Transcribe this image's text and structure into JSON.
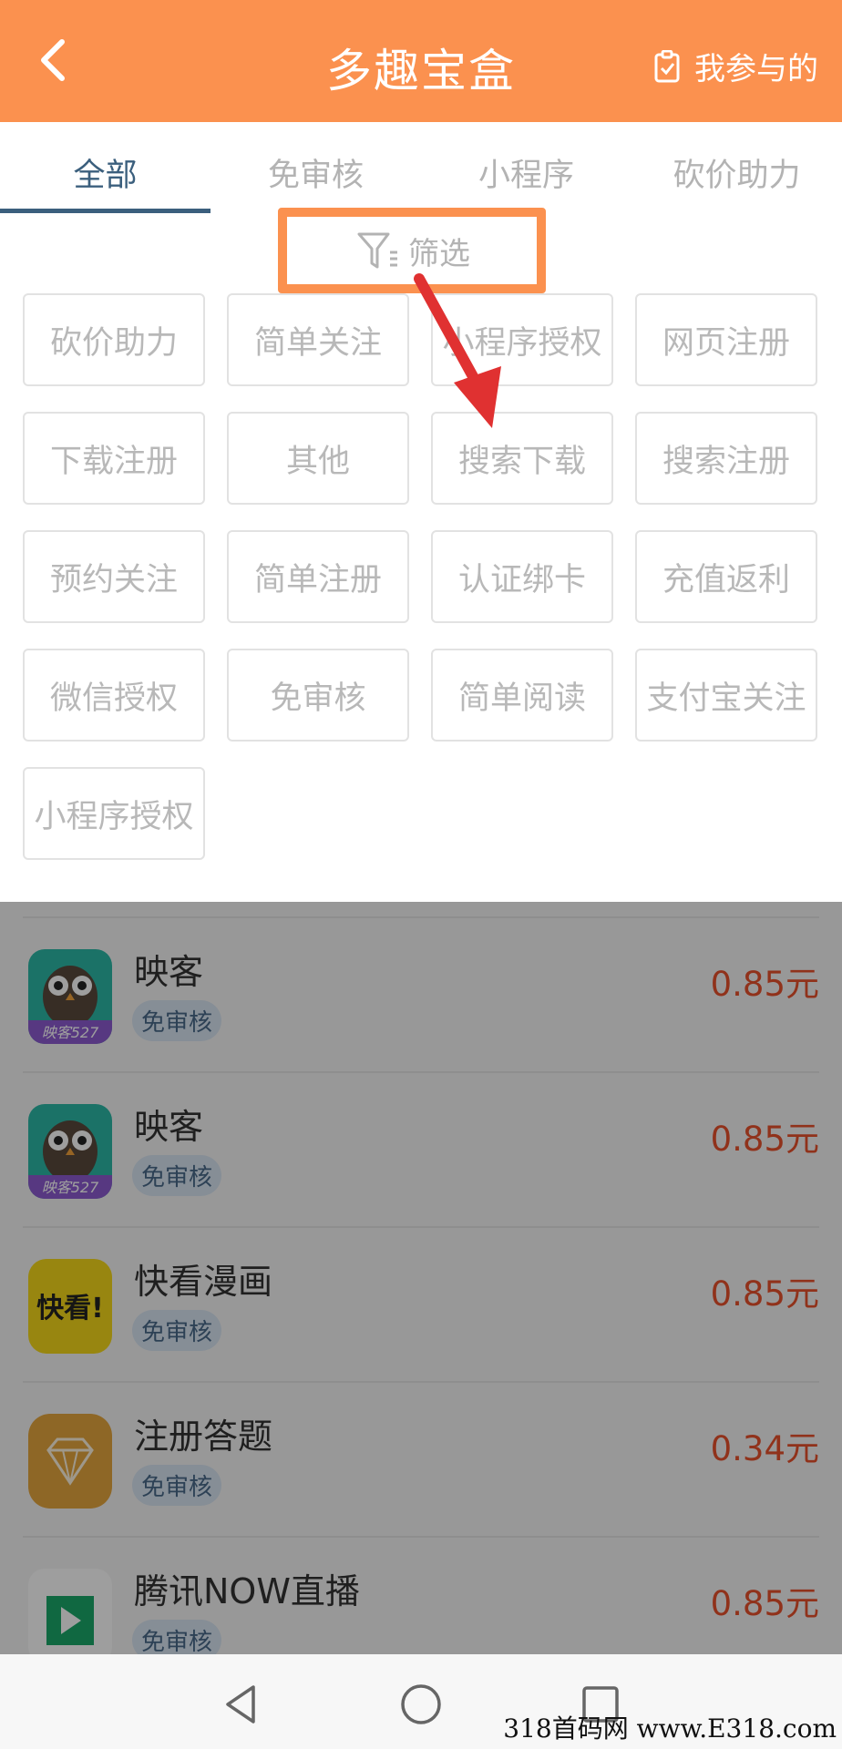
{
  "header": {
    "title": "多趣宝盒",
    "mine_label": "我参与的",
    "bg_color": "#FB914F"
  },
  "tabs": [
    {
      "label": "全部",
      "active": true
    },
    {
      "label": "免审核",
      "active": false
    },
    {
      "label": "小程序",
      "active": false
    },
    {
      "label": "砍价助力",
      "active": false
    }
  ],
  "filter": {
    "label": "筛选",
    "icon": "funnel-icon"
  },
  "filter_options": [
    "砍价助力",
    "简单关注",
    "小程序授权",
    "网页注册",
    "下载注册",
    "其他",
    "搜索下载",
    "搜索注册",
    "预约关注",
    "简单注册",
    "认证绑卡",
    "充值返利",
    "微信授权",
    "免审核",
    "简单阅读",
    "支付宝关注",
    "小程序授权"
  ],
  "tasks": [
    {
      "name": "映客",
      "tag": "免审核",
      "price": "0.85元",
      "icon": "owl-icon",
      "icon_text": "映客527"
    },
    {
      "name": "映客",
      "tag": "免审核",
      "price": "0.85元",
      "icon": "owl-icon",
      "icon_text": "映客527"
    },
    {
      "name": "快看漫画",
      "tag": "免审核",
      "price": "0.85元",
      "icon": "kuaikan-icon",
      "icon_text": "快看!"
    },
    {
      "name": "注册答题",
      "tag": "免审核",
      "price": "0.34元",
      "icon": "diamond-icon",
      "icon_text": ""
    },
    {
      "name": "腾讯NOW直播",
      "tag": "免审核",
      "price": "0.85元",
      "icon": "now-icon",
      "icon_text": ""
    }
  ],
  "nav": {
    "back": "back-triangle-icon",
    "home": "home-circle-icon",
    "recents": "recents-square-icon"
  },
  "watermark": "318首码网 www.E318.com"
}
